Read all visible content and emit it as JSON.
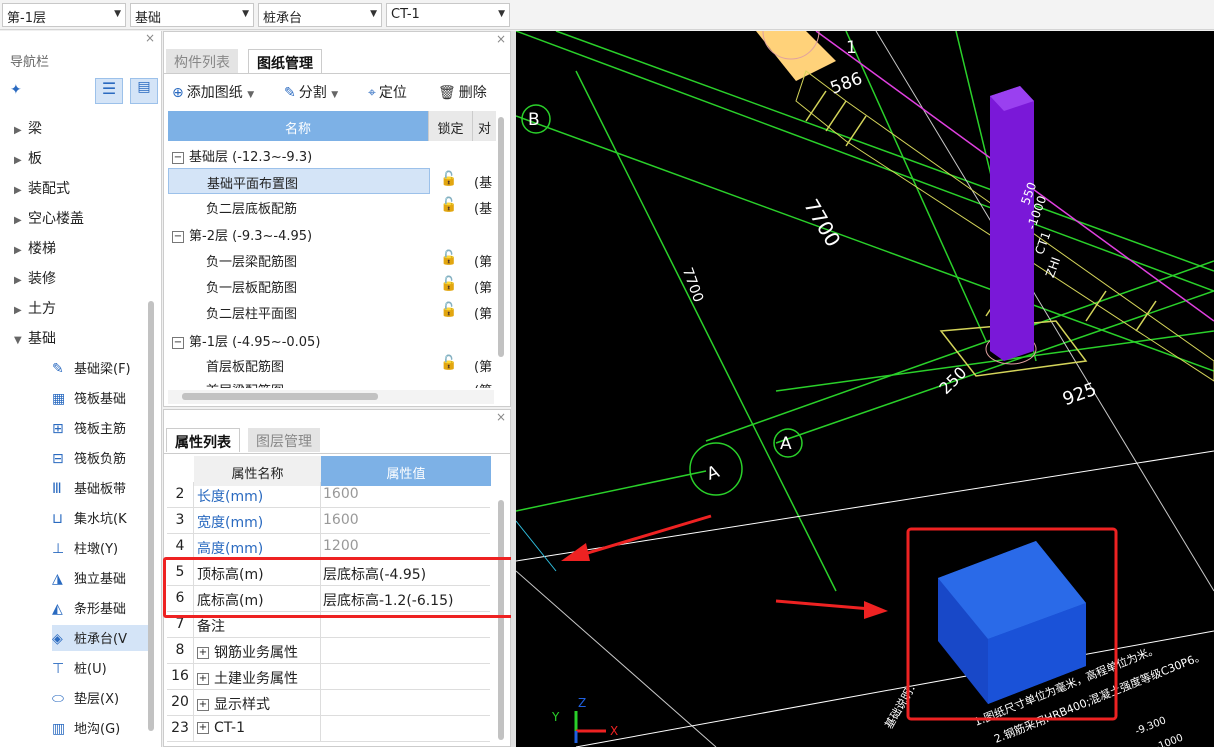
{
  "toolbar": {
    "floor": "第-1层",
    "category": "基础",
    "type": "桩承台",
    "instance": "CT-1"
  },
  "nav": {
    "title": "导航栏",
    "close": "×",
    "items": [
      "梁",
      "板",
      "装配式",
      "空心楼盖",
      "楼梯",
      "装修",
      "土方",
      "基础"
    ],
    "subitems": [
      "基础梁(F)",
      "筏板基础",
      "筏板主筋",
      "筏板负筋",
      "基础板带",
      "集水坑(K",
      "柱墩(Y)",
      "独立基础",
      "条形基础",
      "桩承台(V",
      "桩(U)",
      "垫层(X)",
      "地沟(G)"
    ]
  },
  "drawing_panel": {
    "tabs": [
      "构件列表",
      "图纸管理"
    ],
    "tools": [
      "添加图纸",
      "分割",
      "定位",
      "删除"
    ],
    "headers": [
      "名称",
      "锁定",
      "对"
    ],
    "groups": [
      {
        "label": "基础层 (-12.3~-9.3)",
        "rows": [
          {
            "name": "基础平面布置图",
            "ref": "(基"
          },
          {
            "name": "负二层底板配筋",
            "ref": "(基"
          }
        ]
      },
      {
        "label": "第-2层 (-9.3~-4.95)",
        "rows": [
          {
            "name": "负一层梁配筋图",
            "ref": "(第"
          },
          {
            "name": "负一层板配筋图",
            "ref": "(第"
          },
          {
            "name": "负二层柱平面图",
            "ref": "(第"
          }
        ]
      },
      {
        "label": "第-1层 (-4.95~-0.05)",
        "rows": [
          {
            "name": "首层板配筋图",
            "ref": "(第"
          },
          {
            "name": "首层梁配筋图",
            "ref": "(第"
          }
        ]
      }
    ]
  },
  "prop_panel": {
    "tabs": [
      "属性列表",
      "图层管理"
    ],
    "headers": [
      "属性名称",
      "属性值"
    ],
    "rows": [
      {
        "num": "2",
        "name": "长度(mm)",
        "value": "1600"
      },
      {
        "num": "3",
        "name": "宽度(mm)",
        "value": "1600"
      },
      {
        "num": "4",
        "name": "高度(mm)",
        "value": "1200"
      },
      {
        "num": "5",
        "name": "顶标高(m)",
        "value": "层底标高(-4.95)"
      },
      {
        "num": "6",
        "name": "底标高(m)",
        "value": "层底标高-1.2(-6.15)"
      },
      {
        "num": "7",
        "name": "备注",
        "value": ""
      },
      {
        "num": "8",
        "name": "钢筋业务属性",
        "value": ""
      },
      {
        "num": "16",
        "name": "土建业务属性",
        "value": ""
      },
      {
        "num": "20",
        "name": "显示样式",
        "value": ""
      },
      {
        "num": "23",
        "name": "CT-1",
        "value": ""
      }
    ]
  },
  "cad": {
    "dim1": "7700",
    "dim2": "7700",
    "dim3": "586",
    "dim4": "250",
    "dim5": "925",
    "axisA": "A",
    "axisB": "B",
    "axis1": "1",
    "labels": [
      "ZHI",
      "CT1",
      "-1000",
      "550"
    ],
    "note1": "1.图纸尺寸单位为毫米，高程单位为米。",
    "note2": "2.钢筋采用HRB400;混凝土强度等级C30P6。",
    "note3": "基础说明：",
    "elev": "-9.300",
    "elev2": "-1000"
  }
}
